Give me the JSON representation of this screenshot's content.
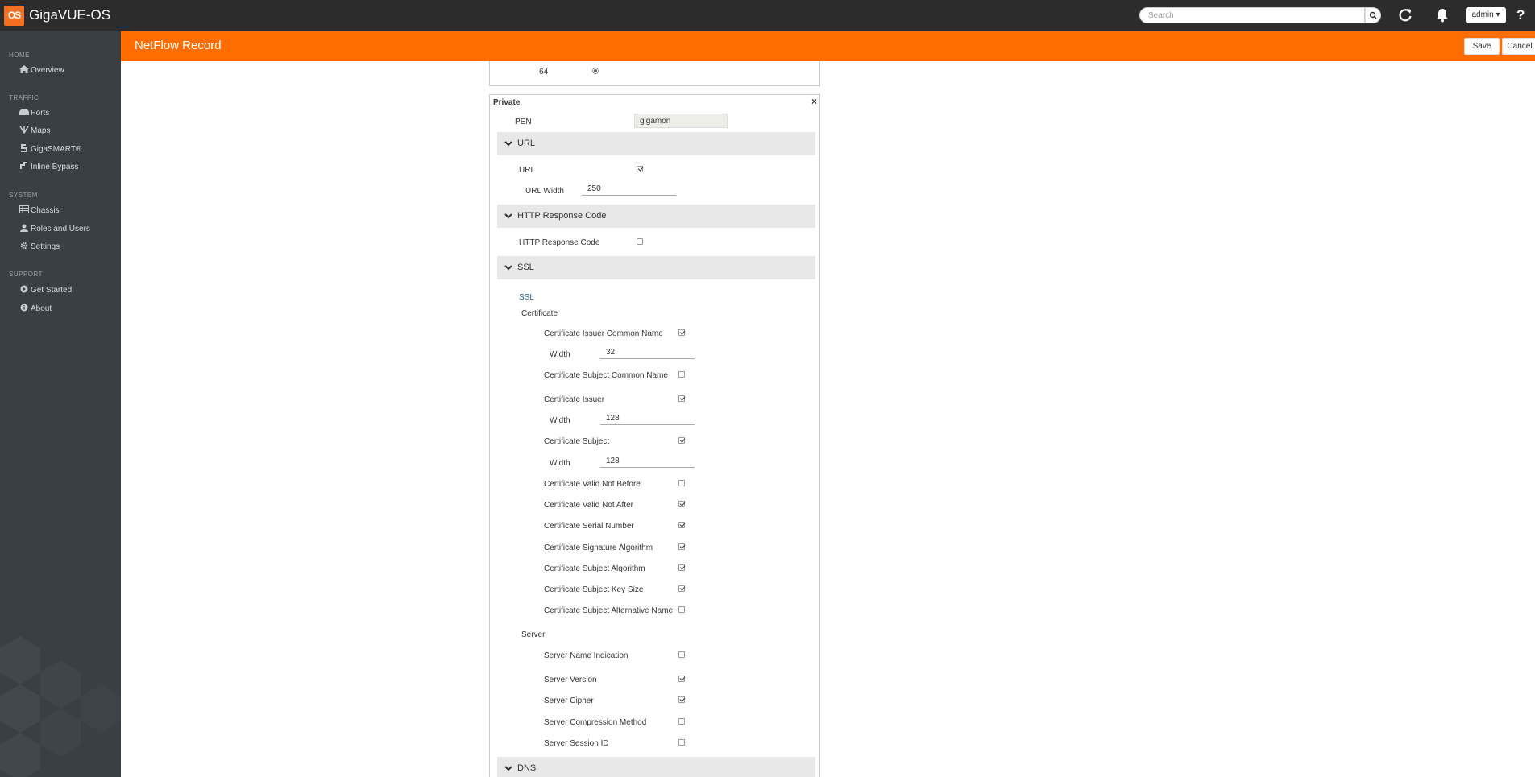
{
  "app": {
    "logo": "OS",
    "title": "GigaVUE-OS"
  },
  "topbar": {
    "search_placeholder": "Search",
    "user": "admin ▾",
    "help": "?"
  },
  "sidebar": {
    "sections": [
      {
        "label": "HOME",
        "items": [
          {
            "label": "Overview",
            "icon": "home-icon"
          }
        ]
      },
      {
        "label": "TRAFFIC",
        "items": [
          {
            "label": "Ports",
            "icon": "ports-icon"
          },
          {
            "label": "Maps",
            "icon": "maps-icon"
          },
          {
            "label": "GigaSMART®",
            "icon": "gigasmart-icon"
          },
          {
            "label": "Inline Bypass",
            "icon": "inline-bypass-icon"
          }
        ]
      },
      {
        "label": "SYSTEM",
        "items": [
          {
            "label": "Chassis",
            "icon": "chassis-icon"
          },
          {
            "label": "Roles and Users",
            "icon": "user-icon"
          },
          {
            "label": "Settings",
            "icon": "gear-icon"
          }
        ]
      },
      {
        "label": "SUPPORT",
        "items": [
          {
            "label": "Get Started",
            "icon": "get-started-icon"
          },
          {
            "label": "About",
            "icon": "info-icon"
          }
        ]
      }
    ]
  },
  "header": {
    "title": "NetFlow Record",
    "save_label": "Save",
    "cancel_label": "Cancel"
  },
  "form": {
    "top_value": "64",
    "private": {
      "title": "Private",
      "close": "×",
      "pen_label": "PEN",
      "pen_value": "gigamon",
      "url_section": {
        "title": "URL",
        "url_label": "URL",
        "url_checked": true,
        "width_label": "URL Width",
        "width_value": "250"
      },
      "http_section": {
        "title": "HTTP Response Code",
        "label": "HTTP Response Code",
        "checked": false
      },
      "ssl_section": {
        "title": "SSL",
        "ssl_label": "SSL",
        "certificate_label": "Certificate",
        "width_label": "Width",
        "cert_items": [
          {
            "label": "Certificate Issuer Common Name",
            "checked": true,
            "width": "32"
          },
          {
            "label": "Certificate Subject Common Name",
            "checked": false
          },
          {
            "label": "Certificate Issuer",
            "checked": true,
            "width": "128"
          },
          {
            "label": "Certificate Subject",
            "checked": true,
            "width": "128"
          },
          {
            "label": "Certificate Valid Not Before",
            "checked": false
          },
          {
            "label": "Certificate Valid Not After",
            "checked": true
          },
          {
            "label": "Certificate Serial Number",
            "checked": true
          },
          {
            "label": "Certificate Signature Algorithm",
            "checked": true
          },
          {
            "label": "Certificate Subject Algorithm",
            "checked": true
          },
          {
            "label": "Certificate Subject Key Size",
            "checked": true
          },
          {
            "label": "Certificate Subject Alternative Name",
            "checked": false
          }
        ],
        "server_label": "Server",
        "server_items": [
          {
            "label": "Server Name Indication",
            "checked": false
          },
          {
            "label": "Server Version",
            "checked": true
          },
          {
            "label": "Server Cipher",
            "checked": true
          },
          {
            "label": "Server Compression Method",
            "checked": false
          },
          {
            "label": "Server Session ID",
            "checked": false
          }
        ]
      },
      "dns_section": {
        "title": "DNS"
      }
    }
  },
  "colors": {
    "topbar": "#2c2c2c",
    "sidebar": "#3a3f44",
    "accent": "#ff6c00",
    "section_bar": "#e8e8e8"
  }
}
